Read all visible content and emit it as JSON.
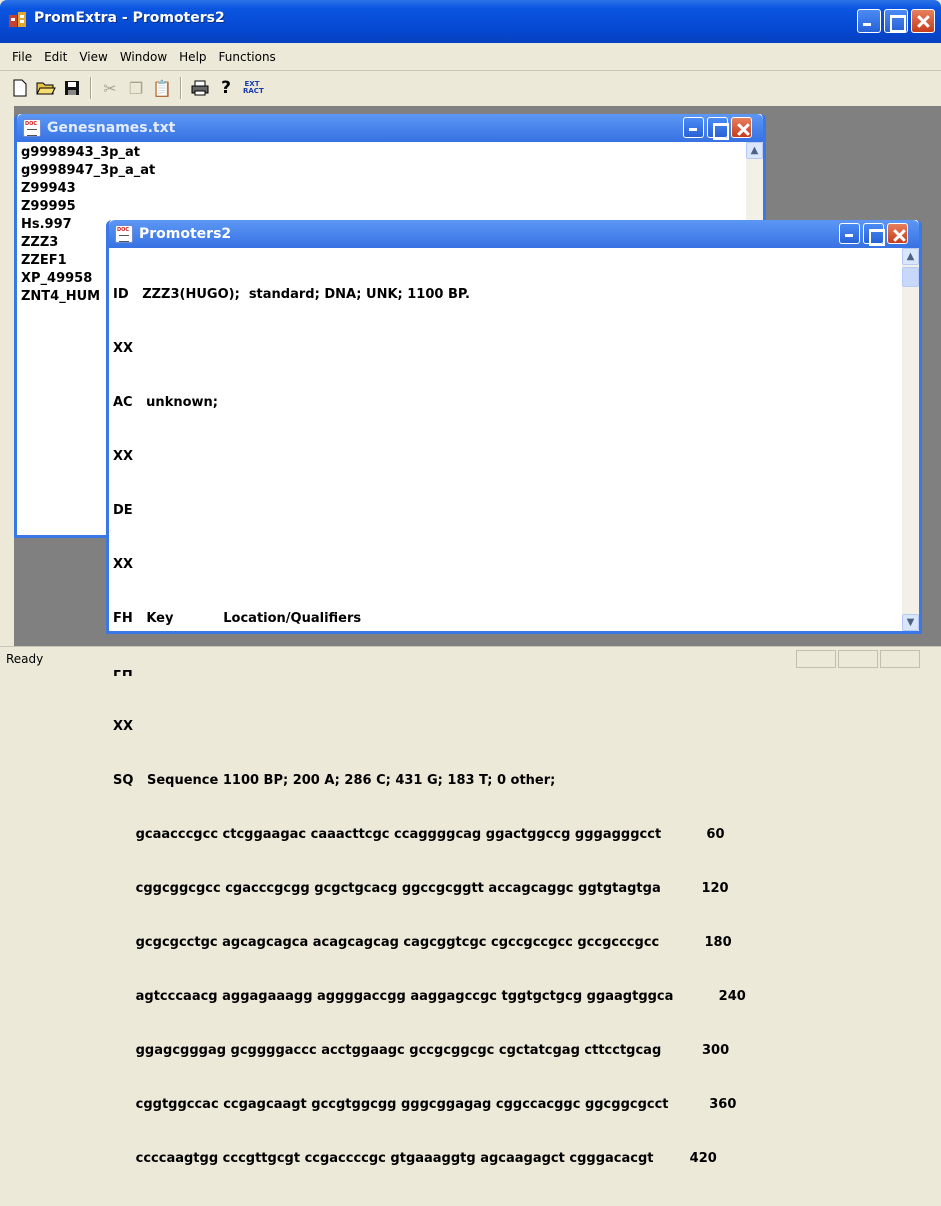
{
  "app": {
    "title": "PromExtra - Promoters2"
  },
  "menu": [
    "File",
    "Edit",
    "View",
    "Window",
    "Help",
    "Functions"
  ],
  "toolbar": {
    "ext_label": "EXT RACT"
  },
  "genes_window": {
    "title": "Genesnames.txt",
    "items": [
      "g9998943_3p_at",
      "g9998947_3p_a_at",
      "Z99943",
      "Z99995",
      "Hs.997",
      "ZZZ3",
      "ZZEF1",
      "XP_49958",
      "ZNT4_HUM"
    ]
  },
  "promoters_window": {
    "title": "Promoters2",
    "lines": [
      "ID   ZZZ3(HUGO);  standard; DNA; UNK; 1100 BP.",
      "XX",
      "AC   unknown;",
      "XX",
      "DE",
      "XX",
      "FH   Key           Location/Qualifiers",
      "FH",
      "XX",
      "SQ   Sequence 1100 BP; 200 A; 286 C; 431 G; 183 T; 0 other;",
      "     gcaacccgcc ctcggaagac caaacttcgc ccaggggcag ggactggccg gggagggcct          60",
      "     cggcggcgcc cgacccgcgg gcgctgcacg ggccgcggtt accagcaggc ggtgtagtga         120",
      "     gcgcgcctgc agcagcagca acagcagcag cagcggtcgc cgccgccgcc gccgcccgcc          180",
      "     agtcccaacg aggagaaagg aggggaccgg aaggagccgc tggtgctgcg ggaagtggca          240",
      "     ggagcgggag gcggggaccc acctggaagc gccgcggcgc cgctatcgag cttcctgcag         300",
      "     cggtggccac ccgagcaagt gccgtggcgg gggcggagag cggccacggc ggcggcgcct         360",
      "     ccccaagtgg cccgttgcgt ccgaccccgc gtgaaaggtg agcaagagct cgggacacgt        420"
    ]
  },
  "status": {
    "text": "Ready"
  }
}
